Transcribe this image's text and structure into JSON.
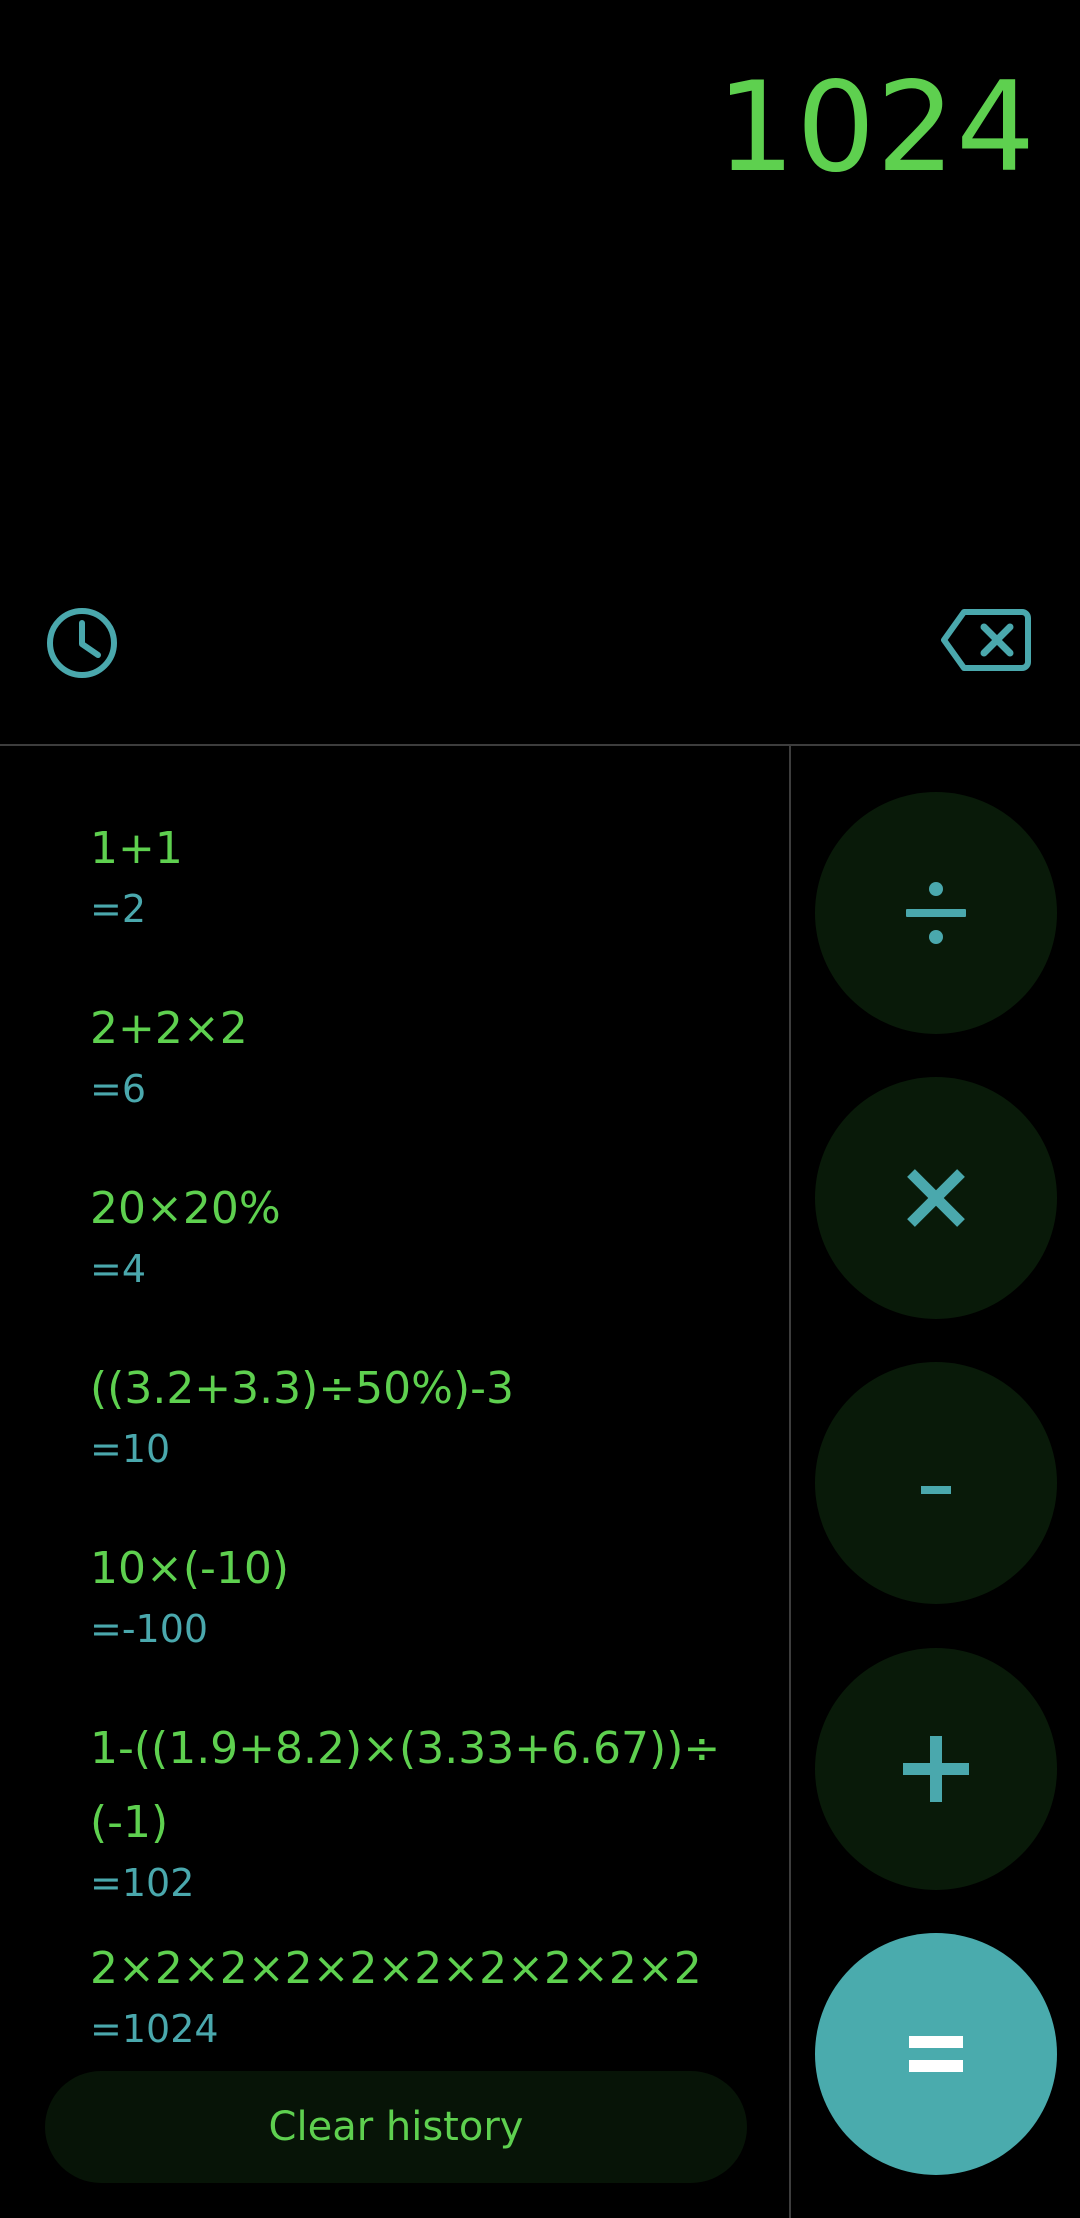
{
  "display": {
    "value": "1024"
  },
  "icons": {
    "history": "clock-icon",
    "backspace": "backspace-icon",
    "divide": "divide-icon",
    "multiply": "multiply-icon",
    "minus": "minus-icon",
    "plus": "plus-icon",
    "equals": "equals-icon"
  },
  "history": [
    {
      "expression": "1+1",
      "result": "=2"
    },
    {
      "expression": "2+2×2",
      "result": "=6"
    },
    {
      "expression": "20×20%",
      "result": "=4"
    },
    {
      "expression": "((3.2+3.3)÷50%)-3",
      "result": "=10"
    },
    {
      "expression": "10×(-10)",
      "result": "=-100"
    },
    {
      "expression": "1-((1.9+8.2)×(3.33+6.67))÷",
      "expression_line2": "(-1)",
      "result": "=102"
    },
    {
      "expression": "2×2×2×2×2×2×2×2×2×2",
      "result": "=1024"
    }
  ],
  "clear_history_label": "Clear history",
  "colors": {
    "background": "#000000",
    "primary_green": "#5ed04f",
    "teal": "#4aabad",
    "button_bg": "#091a09",
    "divider": "#3d3d3d"
  }
}
